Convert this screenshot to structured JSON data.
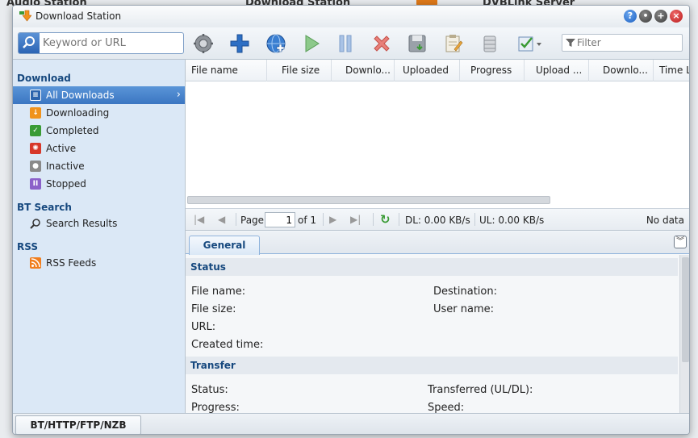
{
  "background": {
    "apps": [
      "Audio Station",
      "Download Station",
      "DVBLink Server"
    ]
  },
  "window": {
    "title": "Download Station",
    "buttons": [
      "help-icon",
      "minimize-icon",
      "maximize-icon",
      "close-icon"
    ]
  },
  "toolbar": {
    "search_placeholder": "Keyword or URL",
    "filter_placeholder": "Filter",
    "icons": [
      "gear-icon",
      "add-icon",
      "add-url-icon",
      "play-icon",
      "pause-icon",
      "delete-icon",
      "save-icon",
      "edit-icon",
      "database-icon",
      "check-icon"
    ]
  },
  "sidebar": {
    "download": {
      "label": "Download",
      "items": [
        {
          "label": "All Downloads",
          "icon": "list-icon",
          "color": "#3b76c2"
        },
        {
          "label": "Downloading",
          "icon": "down-arrow-icon",
          "color": "#f0921c"
        },
        {
          "label": "Completed",
          "icon": "check-icon",
          "color": "#3a9b35"
        },
        {
          "label": "Active",
          "icon": "active-icon",
          "color": "#d7382a"
        },
        {
          "label": "Inactive",
          "icon": "inactive-icon",
          "color": "#8a8a8a"
        },
        {
          "label": "Stopped",
          "icon": "pause-icon",
          "color": "#8b61c9"
        }
      ]
    },
    "bt_search": {
      "label": "BT Search",
      "items": [
        {
          "label": "Search Results",
          "icon": "magnifier-icon"
        }
      ]
    },
    "rss": {
      "label": "RSS",
      "items": [
        {
          "label": "RSS Feeds",
          "icon": "rss-icon",
          "color": "#f07d1d"
        }
      ]
    }
  },
  "grid": {
    "columns": [
      "File name",
      "File size",
      "Downlo...",
      "Uploaded",
      "Progress",
      "Upload ...",
      "Downlo...",
      "Time L"
    ]
  },
  "pager": {
    "page_label": "Page",
    "page_value": "1",
    "of_label": "of 1",
    "dl_speed": "DL: 0.00 KB/s",
    "ul_speed": "UL: 0.00 KB/s",
    "no_data": "No data"
  },
  "detail": {
    "tab": "General",
    "status": {
      "heading": "Status",
      "fields": [
        "File name:",
        "File size:",
        "URL:",
        "Created time:"
      ],
      "fields_right": [
        "Destination:",
        "User name:"
      ]
    },
    "transfer": {
      "heading": "Transfer",
      "fields": [
        "Status:",
        "Progress:"
      ],
      "fields_right": [
        "Transferred (UL/DL):",
        "Speed:"
      ]
    }
  },
  "bottom": {
    "tab": "BT/HTTP/FTP/NZB"
  }
}
